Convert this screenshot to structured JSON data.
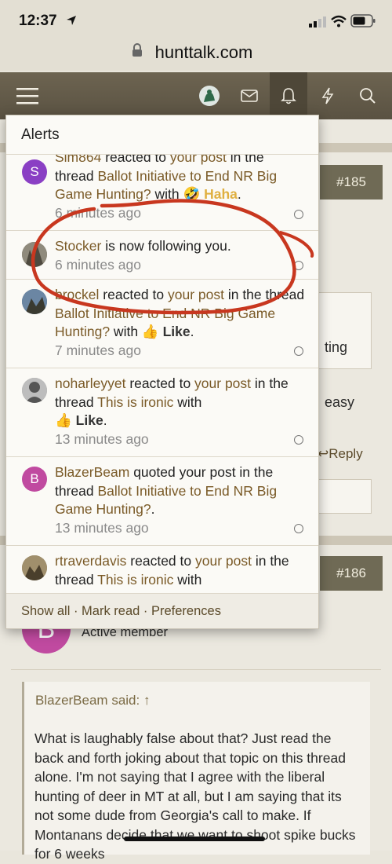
{
  "status": {
    "time": "12:37"
  },
  "browser": {
    "url": "hunttalk.com"
  },
  "nav": {
    "icons": [
      "menu-icon",
      "avatar",
      "mail-icon",
      "bell-icon",
      "bolt-icon",
      "search-icon"
    ]
  },
  "background": {
    "post185": "#185",
    "post186": "#186",
    "partial_ting": "ting",
    "partial_easy": "easy",
    "reply": "Reply",
    "member_role": "Active member",
    "quote_author": "BlazerBeam said:",
    "body_text": "What is laughably false about that? Just read the back and forth joking about that topic on this thread alone. I'm not saying that I agree with the liberal hunting of deer in MT at all, but I am saying that its not some dude from Georgia's call to make. If Montanans decide that we want to shoot spike bucks for 6 weeks"
  },
  "alerts": {
    "title": "Alerts",
    "items": [
      {
        "user": "Slm864",
        "avatar_letter": "S",
        "avatar_color": "#8a3fc4",
        "action": " reacted to ",
        "link": "your post",
        "rest": " in the thread ",
        "thread": "Ballot Initiative to End NR Big Game Hunting?",
        "with": " with ",
        "reaction": "Haha",
        "reaction_icon": "🤣",
        "reaction_color": "#e0b040",
        "time": "6 minutes ago"
      },
      {
        "user": "Stocker",
        "action": " is now following you.",
        "time": "6 minutes ago"
      },
      {
        "user": "brockel",
        "action": " reacted to ",
        "link": "your post",
        "rest": " in the thread ",
        "thread": "Ballot Initiative to End NR Big Game Hunting?",
        "with": " with ",
        "reaction": "Like",
        "reaction_icon": "👍",
        "reaction_color": "#1e6fd0",
        "time": "7 minutes ago"
      },
      {
        "user": "noharleyyet",
        "action": " reacted to ",
        "link": "your post",
        "rest": " in the thread ",
        "thread": "This is ironic",
        "with": " with ",
        "reaction": "Like",
        "reaction_icon": "👍",
        "reaction_color": "#1e6fd0",
        "time": "13 minutes ago"
      },
      {
        "user": "BlazerBeam",
        "avatar_letter": "B",
        "avatar_color": "#c04aa0",
        "action": " quoted your post in the thread ",
        "thread": "Ballot Initiative to End NR Big Game Hunting?",
        "tail": ".",
        "time": "13 minutes ago"
      },
      {
        "user": "rtraverdavis",
        "action": " reacted to ",
        "link": "your post",
        "rest": " in the thread ",
        "thread": "This is ironic",
        "with": " with"
      }
    ],
    "footer": {
      "show_all": "Show all",
      "mark_read": "Mark read",
      "preferences": "Preferences",
      "sep": " · "
    }
  }
}
